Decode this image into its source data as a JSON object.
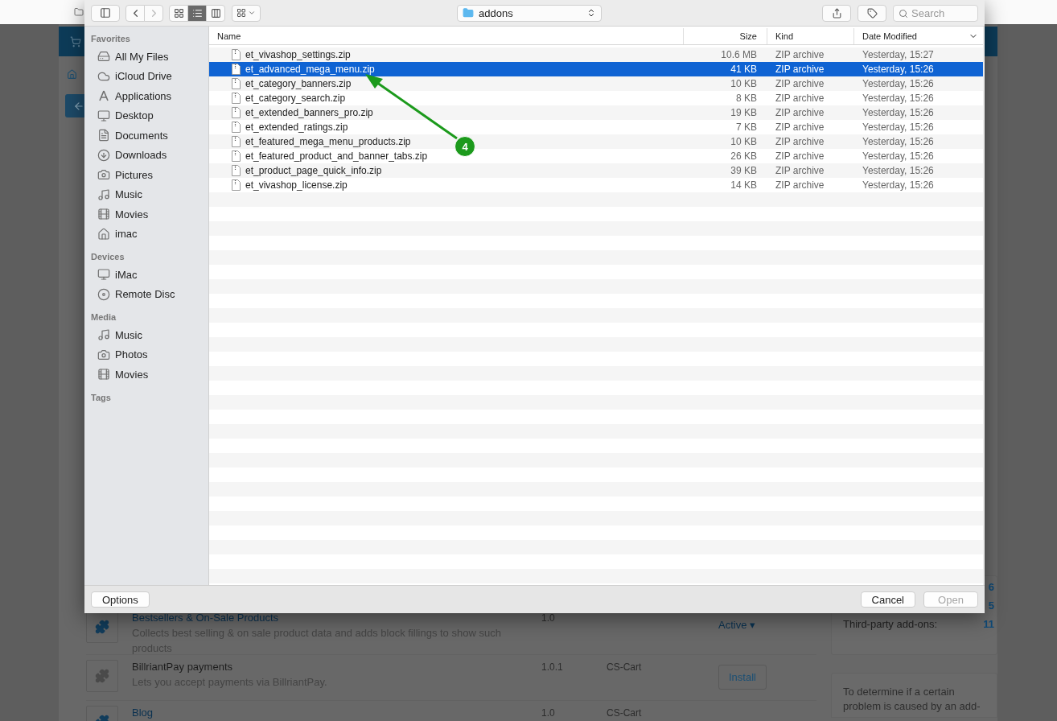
{
  "toolbar": {
    "view_modes": [
      {
        "kind": "icons",
        "selected": false
      },
      {
        "kind": "list",
        "selected": true
      },
      {
        "kind": "columns",
        "selected": false
      }
    ],
    "location": "addons",
    "search": {
      "placeholder": "Search"
    }
  },
  "sidebar": {
    "sections": [
      {
        "title": "Favorites",
        "items": [
          {
            "label": "All My Files",
            "kind": "drive"
          },
          {
            "label": "iCloud Drive",
            "kind": "cloud"
          },
          {
            "label": "Applications",
            "kind": "apps"
          },
          {
            "label": "Desktop",
            "kind": "desktop"
          },
          {
            "label": "Documents",
            "kind": "documents"
          },
          {
            "label": "Downloads",
            "kind": "downloads"
          },
          {
            "label": "Pictures",
            "kind": "camera"
          },
          {
            "label": "Music",
            "kind": "music"
          },
          {
            "label": "Movies",
            "kind": "film"
          },
          {
            "label": "imac",
            "kind": "home"
          }
        ]
      },
      {
        "title": "Devices",
        "items": [
          {
            "label": "iMac",
            "kind": "desktop"
          },
          {
            "label": "Remote Disc",
            "kind": "disc"
          }
        ]
      },
      {
        "title": "Media",
        "items": [
          {
            "label": "Music",
            "kind": "music"
          },
          {
            "label": "Photos",
            "kind": "camera"
          },
          {
            "label": "Movies",
            "kind": "film"
          }
        ]
      },
      {
        "title": "Tags"
      }
    ]
  },
  "file_list": {
    "columns": [
      "Name",
      "Size",
      "Kind",
      "Date Modified"
    ],
    "rows": [
      {
        "name": "et_vivashop_settings.zip",
        "size": "10.6 MB",
        "kind": "ZIP archive",
        "modified": "Yesterday, 15:27",
        "selected": false
      },
      {
        "name": "et_advanced_mega_menu.zip",
        "size": "41 KB",
        "kind": "ZIP archive",
        "modified": "Yesterday, 15:26",
        "selected": true
      },
      {
        "name": "et_category_banners.zip",
        "size": "10 KB",
        "kind": "ZIP archive",
        "modified": "Yesterday, 15:26",
        "selected": false
      },
      {
        "name": "et_category_search.zip",
        "size": "8 KB",
        "kind": "ZIP archive",
        "modified": "Yesterday, 15:26",
        "selected": false
      },
      {
        "name": "et_extended_banners_pro.zip",
        "size": "19 KB",
        "kind": "ZIP archive",
        "modified": "Yesterday, 15:26",
        "selected": false
      },
      {
        "name": "et_extended_ratings.zip",
        "size": "7 KB",
        "kind": "ZIP archive",
        "modified": "Yesterday, 15:26",
        "selected": false
      },
      {
        "name": "et_featured_mega_menu_products.zip",
        "size": "10 KB",
        "kind": "ZIP archive",
        "modified": "Yesterday, 15:26",
        "selected": false
      },
      {
        "name": "et_featured_product_and_banner_tabs.zip",
        "size": "26 KB",
        "kind": "ZIP archive",
        "modified": "Yesterday, 15:26",
        "selected": false
      },
      {
        "name": "et_product_page_quick_info.zip",
        "size": "39 KB",
        "kind": "ZIP archive",
        "modified": "Yesterday, 15:26",
        "selected": false
      },
      {
        "name": "et_vivashop_license.zip",
        "size": "14 KB",
        "kind": "ZIP archive",
        "modified": "Yesterday, 15:26",
        "selected": false
      }
    ]
  },
  "footer": {
    "options": "Options",
    "cancel": "Cancel",
    "open": "Open",
    "open_disabled": true
  },
  "annotation": {
    "number": "4"
  },
  "background": {
    "addons": [
      {
        "title": "Bestsellers & On-Sale Products",
        "description": "Collects best selling & on sale product data and adds block fillings to show such products",
        "version": "1.0",
        "active": true,
        "action": {
          "kind": "status",
          "label": "Active ▾"
        }
      },
      {
        "title": "BillriantPay payments",
        "description": "Lets you accept payments via BillriantPay.",
        "version": "1.0.1",
        "developer": "CS-Cart",
        "active": false,
        "action": {
          "kind": "button",
          "label": "Install"
        }
      },
      {
        "title": "Blog",
        "version": "1.0",
        "developer": "CS-Cart",
        "active": true
      }
    ],
    "stats": [
      {
        "value": "6"
      },
      {
        "value": "5"
      },
      {
        "label": "Third-party add-ons:",
        "value": "11"
      }
    ],
    "help": "To determine if a certain problem is caused by an add-"
  }
}
